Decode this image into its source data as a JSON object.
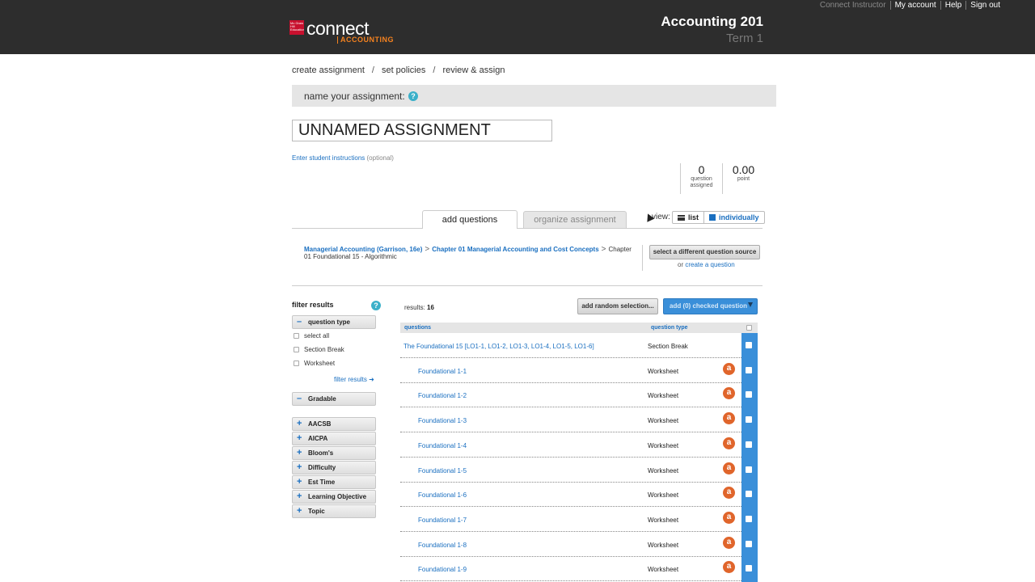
{
  "top_nav": [
    "Connect Instructor",
    "My account",
    "Help",
    "Sign out"
  ],
  "logo": {
    "brand": "connect",
    "product": "ACCOUNTING",
    "mark": "Mc Graw Hill Education"
  },
  "course": {
    "title": "Accounting 201",
    "term": "Term 1"
  },
  "steps": [
    "create assignment",
    "set policies",
    "review & assign"
  ],
  "name_label": "name your assignment:",
  "assignment_name": "UNNAMED ASSIGNMENT",
  "instructions": {
    "link": "Enter student instructions",
    "optional": "(optional)"
  },
  "stats": {
    "questions_value": "0",
    "questions_label": "question assigned",
    "points_value": "0.00",
    "points_label": "point"
  },
  "tabs": {
    "add": "add questions",
    "organize": "organize assignment"
  },
  "view": {
    "label": "view:",
    "list": "list",
    "individually": "individually"
  },
  "breadcrumb": {
    "book": "Managerial Accounting (Garrison, 16e)",
    "chapter": "Chapter 01 Managerial Accounting and Cost Concepts",
    "current": "Chapter 01 Foundational 15 - Algorithmic"
  },
  "source": {
    "button": "select a different question source",
    "or": "or",
    "create": "create a question"
  },
  "filters": {
    "title": "filter results",
    "question_type": "question type",
    "options": [
      "select all",
      "Section Break",
      "Worksheet"
    ],
    "link": "filter results",
    "gradable": "Gradable",
    "collapsed": [
      "AACSB",
      "AICPA",
      "Bloom's",
      "Difficulty",
      "Est Time",
      "Learning Objective",
      "Topic"
    ]
  },
  "results": {
    "label": "results:",
    "count": "16",
    "random_button": "add random selection...",
    "add_button": "add (0) checked question"
  },
  "table": {
    "col_questions": "questions",
    "col_type": "question type",
    "rows": [
      {
        "q": "The Foundational 15 [LO1-1, LO1-2, LO1-3, LO1-4, LO1-5, LO1-6]",
        "t": "Section Break"
      },
      {
        "q": "Foundational 1-1",
        "t": "Worksheet"
      },
      {
        "q": "Foundational 1-2",
        "t": "Worksheet"
      },
      {
        "q": "Foundational 1-3",
        "t": "Worksheet"
      },
      {
        "q": "Foundational 1-4",
        "t": "Worksheet"
      },
      {
        "q": "Foundational 1-5",
        "t": "Worksheet"
      },
      {
        "q": "Foundational 1-6",
        "t": "Worksheet"
      },
      {
        "q": "Foundational 1-7",
        "t": "Worksheet"
      },
      {
        "q": "Foundational 1-8",
        "t": "Worksheet"
      },
      {
        "q": "Foundational 1-9",
        "t": "Worksheet"
      }
    ],
    "algo_icon": "a"
  },
  "colors": {
    "header": "#2d2d2d",
    "accent": "#3a8fd9",
    "link": "#1a6fc0",
    "algo": "#e0652b"
  }
}
